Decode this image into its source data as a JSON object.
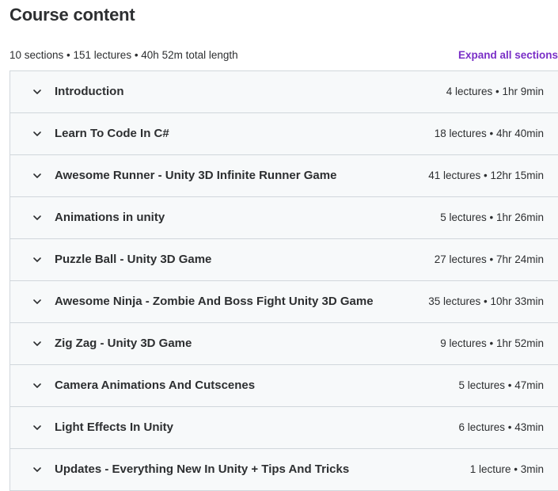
{
  "header": {
    "title": "Course content",
    "summary": "10 sections • 151 lectures • 40h 52m total length",
    "expand_label": "Expand all sections"
  },
  "colors": {
    "accent": "#7a2fc7",
    "row_background": "#f7f9fa",
    "border": "#d1d7dc",
    "text": "#2d2f31"
  },
  "sections": [
    {
      "title": "Introduction",
      "meta": "4 lectures • 1hr 9min"
    },
    {
      "title": "Learn To Code In C#",
      "meta": "18 lectures • 4hr 40min"
    },
    {
      "title": "Awesome Runner - Unity 3D Infinite Runner Game",
      "meta": "41 lectures • 12hr 15min"
    },
    {
      "title": "Animations in unity",
      "meta": "5 lectures • 1hr 26min"
    },
    {
      "title": "Puzzle Ball - Unity 3D Game",
      "meta": "27 lectures • 7hr 24min"
    },
    {
      "title": "Awesome Ninja - Zombie And Boss Fight Unity 3D Game",
      "meta": "35 lectures • 10hr 33min"
    },
    {
      "title": "Zig Zag - Unity 3D Game",
      "meta": "9 lectures • 1hr 52min"
    },
    {
      "title": "Camera Animations And Cutscenes",
      "meta": "5 lectures • 47min"
    },
    {
      "title": "Light Effects In Unity",
      "meta": "6 lectures • 43min"
    },
    {
      "title": "Updates - Everything New In Unity + Tips And Tricks",
      "meta": "1 lecture • 3min"
    }
  ],
  "icons": {
    "row_toggle": "chevron-down-icon"
  }
}
